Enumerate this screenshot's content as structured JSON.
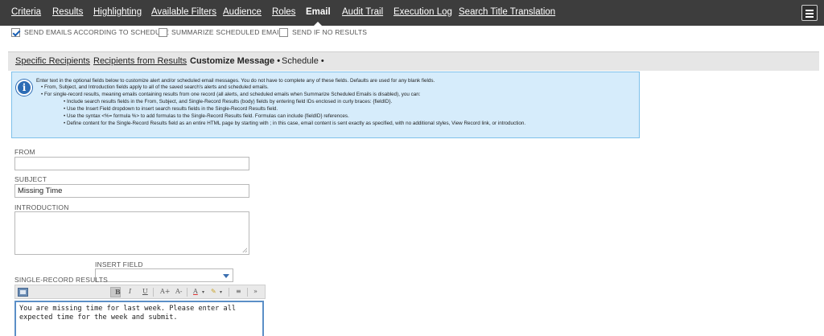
{
  "nav": {
    "tabs": [
      {
        "label": "Criteria"
      },
      {
        "label": "Results"
      },
      {
        "label": "Highlighting"
      },
      {
        "label": "Available Filters"
      },
      {
        "label": "Audience"
      },
      {
        "label": "Roles"
      },
      {
        "label": "Email"
      },
      {
        "label": "Audit Trail"
      },
      {
        "label": "Execution Log"
      },
      {
        "label": "Search Title Translation"
      }
    ],
    "active": "Email"
  },
  "options": {
    "send_emails": {
      "label": "SEND EMAILS ACCORDING TO SCHEDULE",
      "checked": true
    },
    "summarize": {
      "label": "SUMMARIZE SCHEDULED EMAILS",
      "checked": false
    },
    "send_if_none": {
      "label": "SEND IF NO RESULTS",
      "checked": false
    }
  },
  "subtabs": [
    {
      "label": "Specific Recipients"
    },
    {
      "label": "Recipients from Results"
    },
    {
      "label": "Customize Message •"
    },
    {
      "label": "Schedule •"
    }
  ],
  "info": {
    "line1": "Enter text in the optional fields below to customize alert and/or scheduled email messages. You do not have to complete any of these fields. Defaults are used for any blank fields.",
    "line2": "•  From, Subject, and Introduction fields apply to all of the saved search's alerts and scheduled emails.",
    "line3": "•  For single-record results, meaning emails containing results from one record (all alerts, and scheduled emails when Summarize Scheduled Emails is disabled), you can:",
    "line4": "•  Include search results fields in the From, Subject, and Single-Record Results (body) fields by entering field IDs enclosed in curly braces: {fieldID}.",
    "line5": "•  Use the Insert Field dropdown to insert search results fields in the Single-Record Results field.",
    "line6": "•  Use the syntax <%= formula %> to add formulas to the Single-Record Results field. Formulas can include {fieldID} references.",
    "line7": "•  Define content for the Single-Record Results field as an entire HTML page by starting with ; in this case, email content is sent exactly as specified, with no additional styles, View Record link, or introduction."
  },
  "form": {
    "from_label": "FROM",
    "from_value": "",
    "subject_label": "SUBJECT",
    "subject_value": "Missing Time",
    "introduction_label": "INTRODUCTION",
    "introduction_value": "",
    "insert_field_label": "INSERT FIELD",
    "insert_field_value": "",
    "single_record_label": "SINGLE-RECORD RESULTS",
    "body_value": "You are missing time for last week. Please enter all expected time for the week and submit."
  },
  "toolbar": {
    "bold": "B",
    "italic": "I",
    "underline": "U",
    "grow": "A+",
    "shrink": "A-",
    "text_color": "A",
    "more": "»"
  },
  "colors": {
    "nav_bg": "#3d3d3d",
    "info_bg": "#d6ecfb",
    "info_border": "#7ec0ea",
    "accent": "#2d6cb5"
  }
}
